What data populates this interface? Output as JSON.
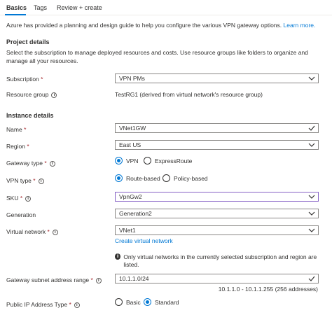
{
  "tabs": [
    {
      "label": "Basics",
      "active": true
    },
    {
      "label": "Tags"
    },
    {
      "label": "Review + create"
    }
  ],
  "intro": {
    "text": "Azure has provided a planning and design guide to help you configure the various VPN gateway options.",
    "link": "Learn more."
  },
  "project": {
    "title": "Project details",
    "desc": "Select the subscription to manage deployed resources and costs. Use resource groups like folders to organize and manage all your resources.",
    "subscription_label": "Subscription",
    "subscription_value": "VPN PMs",
    "rg_label": "Resource group",
    "rg_value": "TestRG1 (derived from virtual network's resource group)"
  },
  "instance": {
    "title": "Instance details",
    "name_label": "Name",
    "name_value": "VNet1GW",
    "region_label": "Region",
    "region_value": "East US",
    "gwtype_label": "Gateway type",
    "gwtype_options": [
      "VPN",
      "ExpressRoute"
    ],
    "vpntype_label": "VPN type",
    "vpntype_options": [
      "Route-based",
      "Policy-based"
    ],
    "sku_label": "SKU",
    "sku_value": "VpnGw2",
    "gen_label": "Generation",
    "gen_value": "Generation2",
    "vnet_label": "Virtual network",
    "vnet_value": "VNet1",
    "vnet_create_link": "Create virtual network",
    "vnet_note": "Only virtual networks in the currently selected subscription and region are listed.",
    "subnet_label": "Gateway subnet address range",
    "subnet_value": "10.1.1.0/24",
    "subnet_range": "10.1.1.0 - 10.1.1.255 (256 addresses)",
    "pip_type_label": "Public IP Address Type",
    "pip_type_options": [
      "Basic",
      "Standard"
    ]
  },
  "required_mark": "*",
  "icons": {
    "info": "info-icon",
    "chevron": "chevron-down-icon",
    "check": "checkmark-icon"
  },
  "colors": {
    "accent": "#0078d4",
    "required": "#a4262c",
    "sku_border": "#8661c5"
  }
}
